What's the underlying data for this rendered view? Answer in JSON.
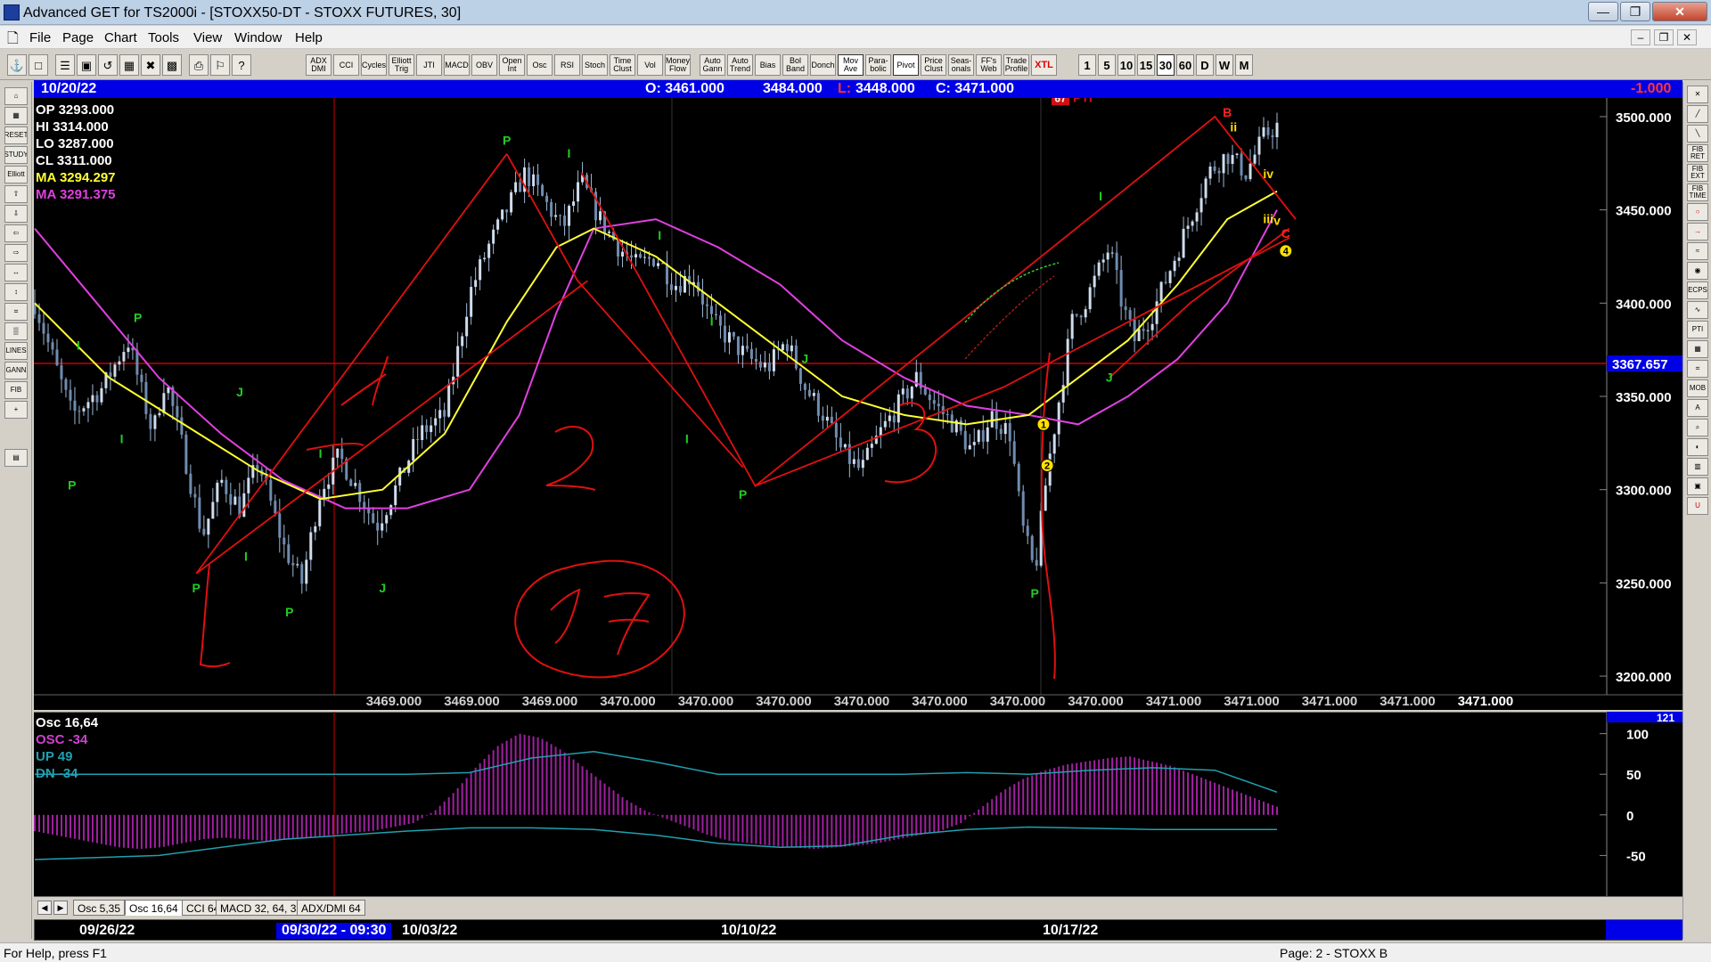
{
  "window": {
    "title": "Advanced GET for TS2000i - [STOXX50-DT - STOXX FUTURES, 30]",
    "buttons": [
      "—",
      "❐",
      "✕"
    ]
  },
  "menu": {
    "items": [
      "File",
      "Page",
      "Chart",
      "Tools",
      "View",
      "Window",
      "Help"
    ],
    "mdi_buttons": [
      "–",
      "❐",
      "✕"
    ]
  },
  "toolbar": {
    "studies": [
      "ADX DMI",
      "CCI",
      "Cycles",
      "Elliott Trig",
      "JTI",
      "MACD",
      "OBV",
      "Open Int",
      "Osc",
      "RSI",
      "Stoch",
      "Time Clust",
      "Vol",
      "Money Flow",
      "Auto Gann",
      "Auto Trend",
      "Bias",
      "Bol Band",
      "Donch",
      "Mov Ave",
      "Para-bolic",
      "Pivot",
      "Price Clust",
      "Seas-onals",
      "FF's Web",
      "Trade Profile",
      "XTL"
    ],
    "intervals": [
      "1",
      "5",
      "10",
      "15",
      "30",
      "60",
      "D",
      "W",
      "M"
    ],
    "active_interval": "30"
  },
  "infobar": {
    "date": "10/20/22",
    "open": "O: 3461.000",
    "high": "3484.000",
    "low_label": "L:",
    "low": "3448.000",
    "close": "C: 3471.000",
    "change": "-1.000"
  },
  "legend": {
    "op": "OP  3293.000",
    "hi": "HI   3314.000",
    "lo": "LO  3287.000",
    "cl": "CL  3311.000",
    "ma1": "MA  3294.297",
    "ma2": "MA  3291.375"
  },
  "chart_data": {
    "type": "candlestick",
    "symbol": "STOXX50-DT - STOXX FUTURES, 30",
    "ylim": [
      3190,
      3510
    ],
    "yticks": [
      "3500.000",
      "3450.000",
      "3400.000",
      "3350.000",
      "3300.000",
      "3250.000",
      "3200.000"
    ],
    "current_price": "3367.657",
    "pti": "67",
    "pti_label": "PTI",
    "bottom_values": [
      "3469.000",
      "3469.000",
      "3469.000",
      "3470.000",
      "3470.000",
      "3470.000",
      "3470.000",
      "3470.000",
      "3470.000",
      "3470.000",
      "3471.000",
      "3471.000",
      "3471.000",
      "3471.000",
      "3471.000"
    ],
    "close_path": [
      [
        0,
        3400
      ],
      [
        0.03,
        3340
      ],
      [
        0.055,
        3355
      ],
      [
        0.075,
        3380
      ],
      [
        0.095,
        3330
      ],
      [
        0.105,
        3360
      ],
      [
        0.12,
        3320
      ],
      [
        0.135,
        3275
      ],
      [
        0.15,
        3305
      ],
      [
        0.165,
        3290
      ],
      [
        0.18,
        3315
      ],
      [
        0.2,
        3270
      ],
      [
        0.215,
        3250
      ],
      [
        0.23,
        3300
      ],
      [
        0.245,
        3318
      ],
      [
        0.26,
        3300
      ],
      [
        0.275,
        3280
      ],
      [
        0.29,
        3300
      ],
      [
        0.31,
        3330
      ],
      [
        0.33,
        3340
      ],
      [
        0.35,
        3405
      ],
      [
        0.365,
        3430
      ],
      [
        0.38,
        3450
      ],
      [
        0.395,
        3470
      ],
      [
        0.41,
        3455
      ],
      [
        0.425,
        3440
      ],
      [
        0.44,
        3465
      ],
      [
        0.455,
        3445
      ],
      [
        0.47,
        3430
      ],
      [
        0.485,
        3420
      ],
      [
        0.5,
        3425
      ],
      [
        0.515,
        3410
      ],
      [
        0.53,
        3415
      ],
      [
        0.545,
        3390
      ],
      [
        0.56,
        3380
      ],
      [
        0.575,
        3370
      ],
      [
        0.59,
        3365
      ],
      [
        0.605,
        3380
      ],
      [
        0.62,
        3355
      ],
      [
        0.635,
        3340
      ],
      [
        0.65,
        3320
      ],
      [
        0.665,
        3310
      ],
      [
        0.68,
        3330
      ],
      [
        0.695,
        3345
      ],
      [
        0.71,
        3360
      ],
      [
        0.725,
        3345
      ],
      [
        0.74,
        3335
      ],
      [
        0.755,
        3320
      ],
      [
        0.77,
        3340
      ],
      [
        0.785,
        3330
      ],
      [
        0.795,
        3280
      ],
      [
        0.805,
        3255
      ],
      [
        0.815,
        3310
      ],
      [
        0.825,
        3350
      ],
      [
        0.835,
        3390
      ],
      [
        0.845,
        3400
      ],
      [
        0.855,
        3415
      ],
      [
        0.865,
        3430
      ],
      [
        0.875,
        3400
      ],
      [
        0.885,
        3380
      ],
      [
        0.9,
        3395
      ],
      [
        0.915,
        3420
      ],
      [
        0.93,
        3445
      ],
      [
        0.945,
        3470
      ],
      [
        0.96,
        3480
      ],
      [
        0.975,
        3470
      ],
      [
        0.99,
        3490
      ],
      [
        1.0,
        3495
      ]
    ],
    "ma_yellow": [
      [
        0,
        3400
      ],
      [
        0.06,
        3360
      ],
      [
        0.12,
        3335
      ],
      [
        0.18,
        3310
      ],
      [
        0.23,
        3295
      ],
      [
        0.28,
        3300
      ],
      [
        0.33,
        3330
      ],
      [
        0.38,
        3390
      ],
      [
        0.42,
        3430
      ],
      [
        0.45,
        3440
      ],
      [
        0.5,
        3425
      ],
      [
        0.55,
        3400
      ],
      [
        0.6,
        3375
      ],
      [
        0.65,
        3350
      ],
      [
        0.7,
        3340
      ],
      [
        0.75,
        3335
      ],
      [
        0.8,
        3340
      ],
      [
        0.84,
        3360
      ],
      [
        0.88,
        3380
      ],
      [
        0.92,
        3410
      ],
      [
        0.96,
        3445
      ],
      [
        1.0,
        3460
      ]
    ],
    "ma_magenta": [
      [
        0,
        3440
      ],
      [
        0.05,
        3400
      ],
      [
        0.1,
        3360
      ],
      [
        0.15,
        3330
      ],
      [
        0.2,
        3305
      ],
      [
        0.25,
        3290
      ],
      [
        0.3,
        3290
      ],
      [
        0.35,
        3300
      ],
      [
        0.39,
        3340
      ],
      [
        0.42,
        3395
      ],
      [
        0.45,
        3440
      ],
      [
        0.5,
        3445
      ],
      [
        0.55,
        3430
      ],
      [
        0.6,
        3410
      ],
      [
        0.65,
        3380
      ],
      [
        0.7,
        3360
      ],
      [
        0.75,
        3345
      ],
      [
        0.8,
        3340
      ],
      [
        0.84,
        3335
      ],
      [
        0.88,
        3350
      ],
      [
        0.92,
        3370
      ],
      [
        0.96,
        3400
      ],
      [
        1.0,
        3450
      ]
    ],
    "wave_labels": [
      {
        "t": "P",
        "x": 0.03,
        "y": 3300,
        "c": "#22cc22"
      },
      {
        "t": "P",
        "x": 0.083,
        "y": 3390,
        "c": "#22cc22"
      },
      {
        "t": "P",
        "x": 0.13,
        "y": 3245,
        "c": "#22cc22"
      },
      {
        "t": "P",
        "x": 0.205,
        "y": 3232,
        "c": "#22cc22"
      },
      {
        "t": "P",
        "x": 0.38,
        "y": 3485,
        "c": "#22cc22"
      },
      {
        "t": "P",
        "x": 0.57,
        "y": 3295,
        "c": "#22cc22"
      },
      {
        "t": "P",
        "x": 0.805,
        "y": 3242,
        "c": "#22cc22"
      },
      {
        "t": "J",
        "x": 0.165,
        "y": 3350,
        "c": "#22cc22"
      },
      {
        "t": "J",
        "x": 0.28,
        "y": 3245,
        "c": "#22cc22"
      },
      {
        "t": "J",
        "x": 0.62,
        "y": 3368,
        "c": "#22cc22"
      },
      {
        "t": "J",
        "x": 0.865,
        "y": 3358,
        "c": "#22cc22"
      },
      {
        "t": "I",
        "x": 0.035,
        "y": 3375,
        "c": "#22cc22"
      },
      {
        "t": "I",
        "x": 0.07,
        "y": 3325,
        "c": "#22cc22"
      },
      {
        "t": "I",
        "x": 0.17,
        "y": 3262,
        "c": "#22cc22"
      },
      {
        "t": "I",
        "x": 0.23,
        "y": 3317,
        "c": "#22cc22"
      },
      {
        "t": "I",
        "x": 0.43,
        "y": 3478,
        "c": "#22cc22"
      },
      {
        "t": "I",
        "x": 0.503,
        "y": 3434,
        "c": "#22cc22"
      },
      {
        "t": "I",
        "x": 0.525,
        "y": 3325,
        "c": "#22cc22"
      },
      {
        "t": "I",
        "x": 0.545,
        "y": 3388,
        "c": "#22cc22"
      },
      {
        "t": "I",
        "x": 0.858,
        "y": 3455,
        "c": "#22cc22"
      },
      {
        "t": "B",
        "x": 0.96,
        "y": 3500,
        "c": "#ff2222"
      },
      {
        "t": "ii",
        "x": 0.965,
        "y": 3492,
        "c": "#ffdd00"
      },
      {
        "t": "iv",
        "x": 0.993,
        "y": 3467,
        "c": "#ffdd00"
      },
      {
        "t": "iii",
        "x": 0.993,
        "y": 3443,
        "c": "#ffdd00"
      },
      {
        "t": "v",
        "x": 1.0,
        "y": 3442,
        "c": "#ffdd00"
      },
      {
        "t": "C",
        "x": 1.007,
        "y": 3435,
        "c": "#ff2222"
      }
    ],
    "wave_markers": [
      {
        "n": "1",
        "x": 0.812,
        "y": 3335
      },
      {
        "n": "2",
        "x": 0.815,
        "y": 3313
      },
      {
        "n": "4",
        "x": 1.007,
        "y": 3428
      }
    ],
    "annotations": [
      "1",
      "2",
      "3",
      "17"
    ]
  },
  "oscillator": {
    "title": "Osc 16,64",
    "osc": "OSC -34",
    "up": "UP  49",
    "dn": "DN  -34",
    "ylim": [
      -100,
      127
    ],
    "yticks": [
      "100",
      "50",
      "0",
      "-50"
    ],
    "top_value": "121",
    "values": [
      -20,
      -25,
      -30,
      -35,
      -40,
      -42,
      -40,
      -35,
      -30,
      -28,
      -30,
      -32,
      -30,
      -28,
      -25,
      -22,
      -20,
      -15,
      -10,
      5,
      30,
      60,
      85,
      100,
      95,
      80,
      60,
      40,
      20,
      5,
      -5,
      -15,
      -25,
      -32,
      -35,
      -38,
      -40,
      -42,
      -40,
      -38,
      -35,
      -30,
      -25,
      -20,
      -10,
      10,
      30,
      45,
      55,
      62,
      66,
      70,
      72,
      66,
      60,
      50,
      40,
      30,
      20,
      10
    ],
    "up_line": [
      [
        0,
        50
      ],
      [
        0.3,
        50
      ],
      [
        0.35,
        52
      ],
      [
        0.4,
        70
      ],
      [
        0.45,
        78
      ],
      [
        0.5,
        65
      ],
      [
        0.55,
        50
      ],
      [
        0.7,
        50
      ],
      [
        0.75,
        52
      ],
      [
        0.8,
        50
      ],
      [
        0.85,
        55
      ],
      [
        0.9,
        58
      ],
      [
        0.95,
        55
      ],
      [
        1.0,
        28
      ]
    ],
    "dn_line": [
      [
        0,
        -55
      ],
      [
        0.1,
        -50
      ],
      [
        0.2,
        -30
      ],
      [
        0.3,
        -20
      ],
      [
        0.35,
        -16
      ],
      [
        0.4,
        -16
      ],
      [
        0.45,
        -18
      ],
      [
        0.5,
        -25
      ],
      [
        0.55,
        -35
      ],
      [
        0.6,
        -40
      ],
      [
        0.65,
        -38
      ],
      [
        0.7,
        -25
      ],
      [
        0.75,
        -18
      ],
      [
        0.8,
        -15
      ],
      [
        0.9,
        -18
      ],
      [
        1.0,
        -18
      ]
    ]
  },
  "tabs": {
    "items": [
      "Osc 5,35",
      "Osc 16,64",
      "CCI 64",
      "MACD 32, 64, 32",
      "ADX/DMI 64"
    ],
    "active": "Osc 16,64"
  },
  "dates": {
    "d1": "09/26/22",
    "d2": "09/30/22 - 09:30",
    "d3": "10/03/22",
    "d4": "10/10/22",
    "d5": "10/17/22"
  },
  "status": {
    "help": "For Help, press F1",
    "page": "Page: 2 - STOXX B"
  }
}
